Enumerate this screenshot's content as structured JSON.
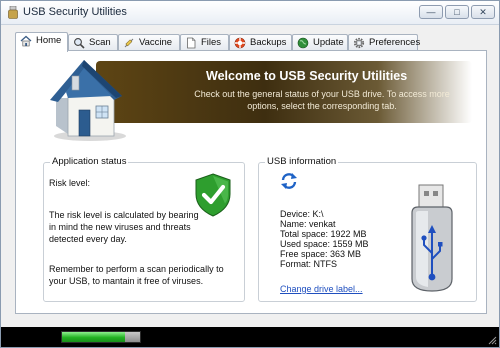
{
  "window": {
    "title": "USB Security Utilities",
    "controls": {
      "minimize": "—",
      "maximize": "□",
      "close": "✕"
    }
  },
  "tabs": [
    {
      "label": "Home",
      "icon": "home-icon",
      "active": true
    },
    {
      "label": "Scan",
      "icon": "magnifier-icon",
      "active": false
    },
    {
      "label": "Vaccine",
      "icon": "syringe-icon",
      "active": false
    },
    {
      "label": "Files",
      "icon": "document-icon",
      "active": false
    },
    {
      "label": "Backups",
      "icon": "lifebuoy-icon",
      "active": false
    },
    {
      "label": "Update",
      "icon": "globe-icon",
      "active": false
    },
    {
      "label": "Preferences",
      "icon": "gear-icon",
      "active": false
    }
  ],
  "banner": {
    "title": "Welcome to USB Security Utilities",
    "subtitle": "Check out the general status of your USB drive. To access more options, select the corresponding tab."
  },
  "app_status": {
    "title": "Application status",
    "risk_label": "Risk level:",
    "risk_description": "The risk level is calculated by bearing in mind the new viruses and threats detected every day.",
    "reminder": "Remember to perform a scan periodically to your USB, to mantain it free of viruses."
  },
  "usb_info": {
    "title": "USB information",
    "device": "Device: K:\\",
    "name": "Name: venkat",
    "total_space": "Total space: 1922 MB",
    "used_space": "Used space: 1559 MB",
    "free_space": "Free space: 363 MB",
    "format": "Format: NTFS",
    "change_drive_link": "Change drive label..."
  },
  "status_bar": {
    "progress_fraction": 0.81
  },
  "colors": {
    "accent": "#1f4fbf",
    "banner": "#3e2e10",
    "shield_green": "#2e9e2e",
    "progress_green": "#22b222"
  }
}
